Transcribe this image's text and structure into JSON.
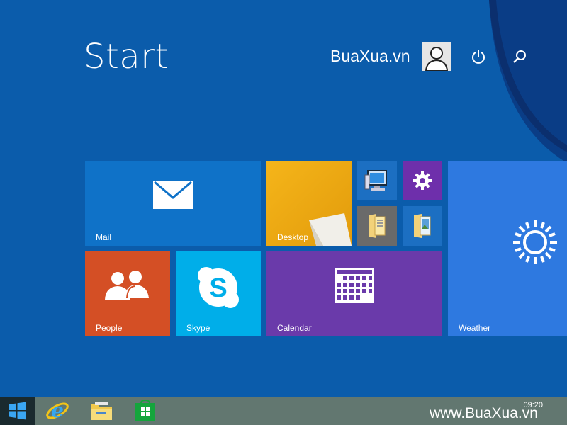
{
  "start": {
    "title": "Start",
    "username": "BuaXua.vn"
  },
  "tiles": {
    "mail": "Mail",
    "desktop": "Desktop",
    "people": "People",
    "skype": "Skype",
    "calendar": "Calendar",
    "weather": "Weather"
  },
  "icons": {
    "power": "power-icon",
    "search": "search-icon",
    "user": "user-avatar-icon"
  },
  "taskbar": {
    "clock": "09:20",
    "watermark": "www.BuaXua.vn"
  },
  "colors": {
    "background": "#0b5cab",
    "mail": "#0f72c8",
    "desktop": "#e8a70f",
    "people": "#d44f25",
    "skype": "#00aee9",
    "calendar": "#6a3aaa",
    "weather": "#2e79e0",
    "taskbar": "#627770"
  }
}
